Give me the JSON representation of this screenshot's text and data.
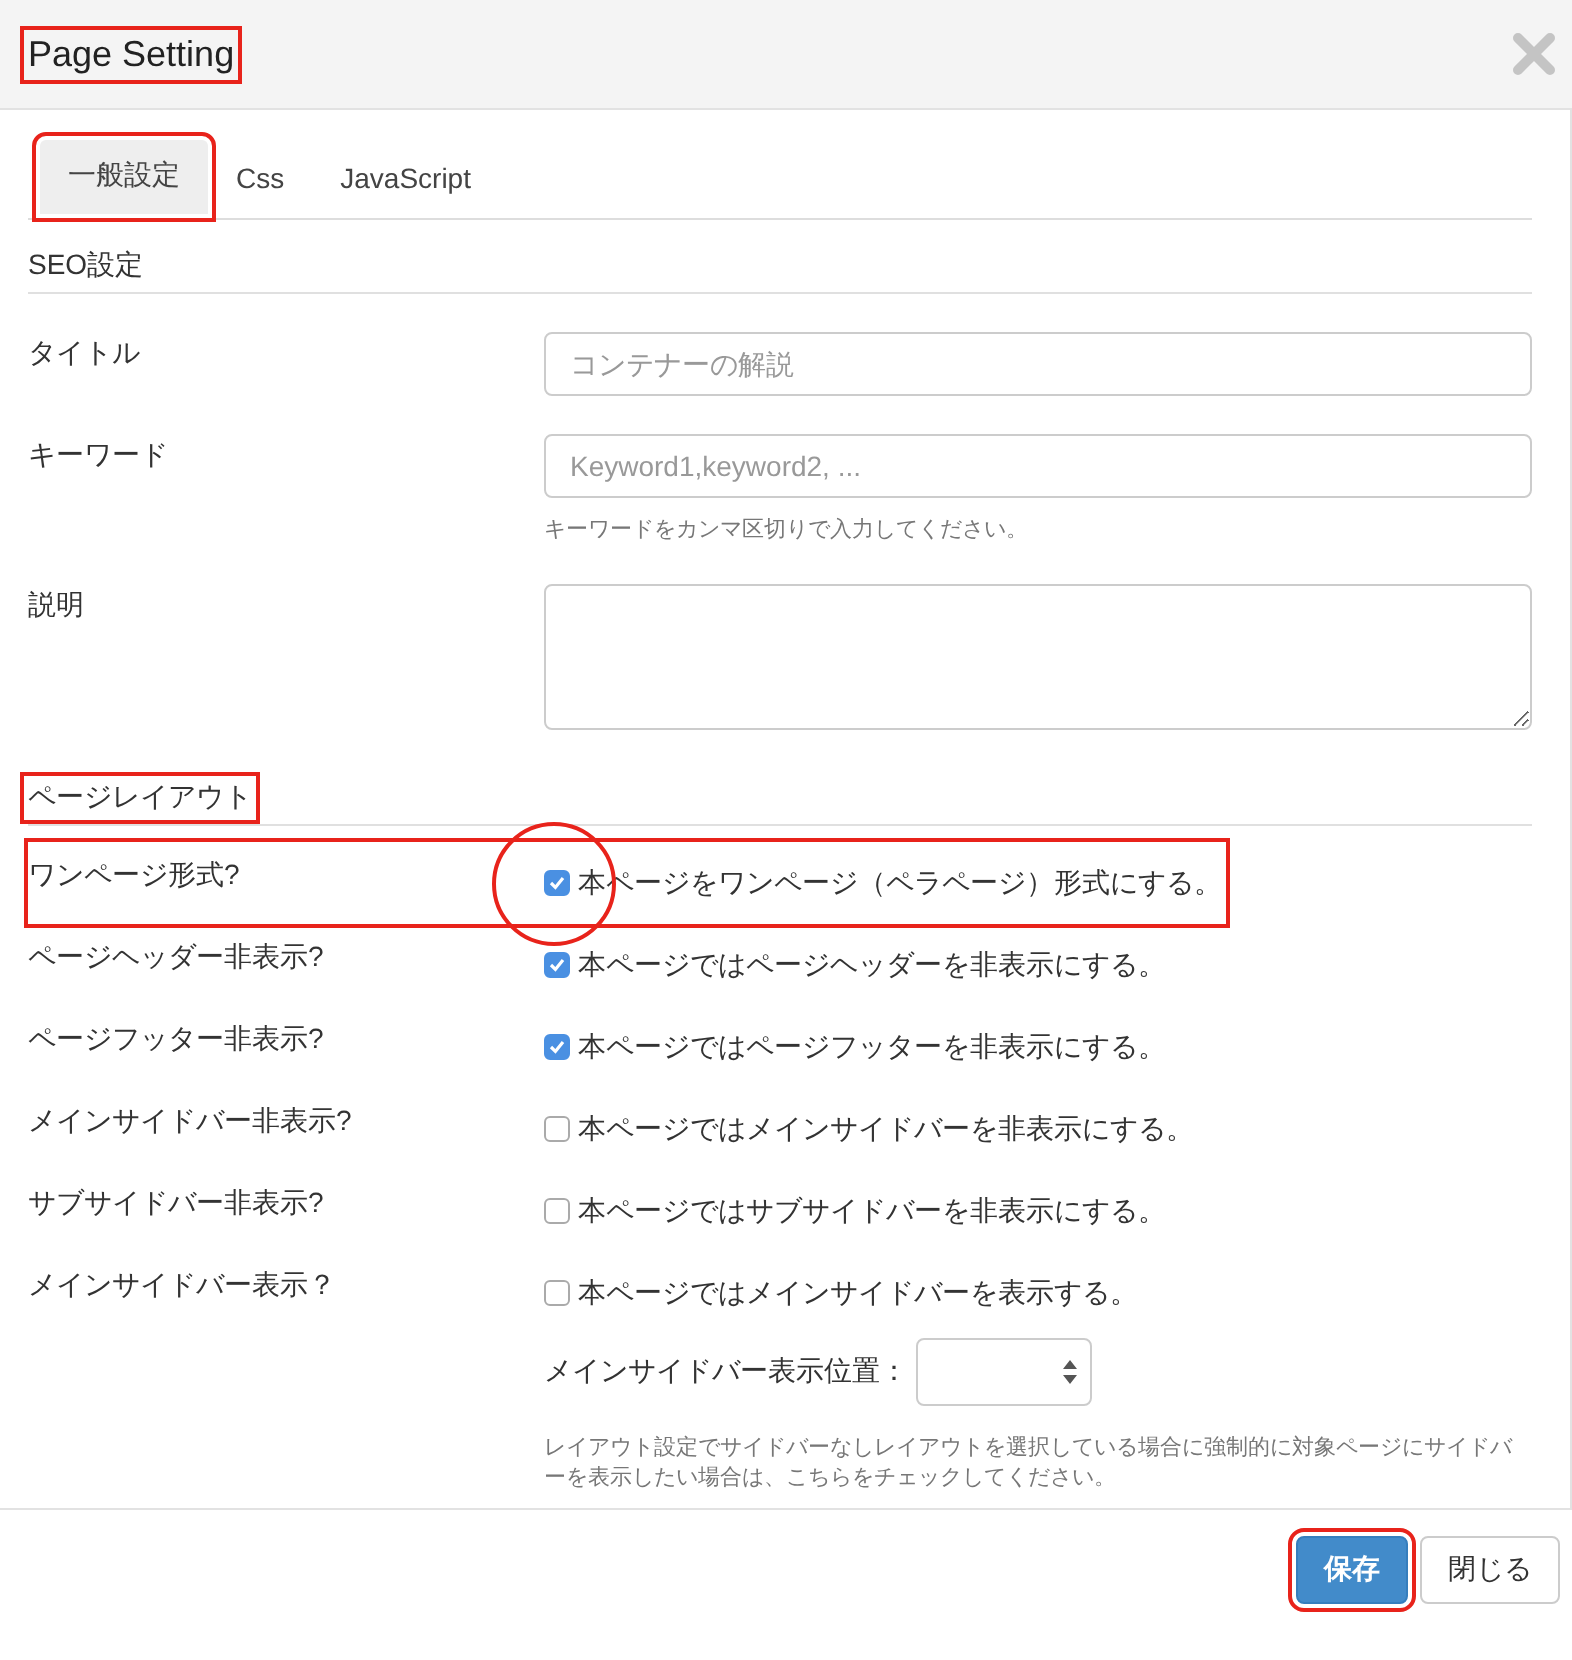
{
  "dialog": {
    "title": "Page Setting",
    "title_highlighted": true
  },
  "tabs": [
    {
      "label": "一般設定",
      "selected": true,
      "highlighted": true
    },
    {
      "label": "Css",
      "selected": false,
      "highlighted": false
    },
    {
      "label": "JavaScript",
      "selected": false,
      "highlighted": false
    }
  ],
  "seo": {
    "heading": "SEO設定",
    "fields": [
      {
        "kind": "input",
        "label": "タイトル",
        "placeholder": "コンテナーの解説"
      },
      {
        "kind": "input",
        "label": "キーワード",
        "placeholder": "Keyword1,keyword2, ...",
        "help": "キーワードをカンマ区切りで入力してください。"
      },
      {
        "kind": "textarea",
        "label": "説明"
      }
    ]
  },
  "layout": {
    "heading": "ページレイアウト",
    "highlighted": true,
    "options": [
      {
        "label": "ワンページ形式?",
        "checkbox_label": "本ページをワンページ（ペラページ）形式にする。",
        "checked": true,
        "highlighted": true,
        "circled": true
      },
      {
        "label": "ページヘッダー非表示?",
        "checkbox_label": "本ページではページヘッダーを非表示にする。",
        "checked": true,
        "highlighted": false,
        "circled": false
      },
      {
        "label": "ページフッター非表示?",
        "checkbox_label": "本ページではページフッターを非表示にする。",
        "checked": true,
        "highlighted": false,
        "circled": false
      },
      {
        "label": "メインサイドバー非表示?",
        "checkbox_label": "本ページではメインサイドバーを非表示にする。",
        "checked": false,
        "highlighted": false,
        "circled": false
      },
      {
        "label": "サブサイドバー非表示?",
        "checkbox_label": "本ページではサブサイドバーを非表示にする。",
        "checked": false,
        "highlighted": false,
        "circled": false
      },
      {
        "label": "メインサイドバー表示？",
        "checkbox_label": "本ページではメインサイドバーを表示する。",
        "checked": false,
        "highlighted": false,
        "circled": false
      }
    ],
    "position": {
      "label": "メインサイドバー表示位置：",
      "help": "レイアウト設定でサイドバーなしレイアウトを選択している場合に強制的に対象ページにサイドバーを表示したい場合は、こちらをチェックしてください。"
    }
  },
  "buttons": [
    {
      "kind": "primary",
      "label": "保存",
      "highlighted": true
    },
    {
      "kind": "default",
      "label": "閉じる",
      "highlighted": false
    }
  ]
}
